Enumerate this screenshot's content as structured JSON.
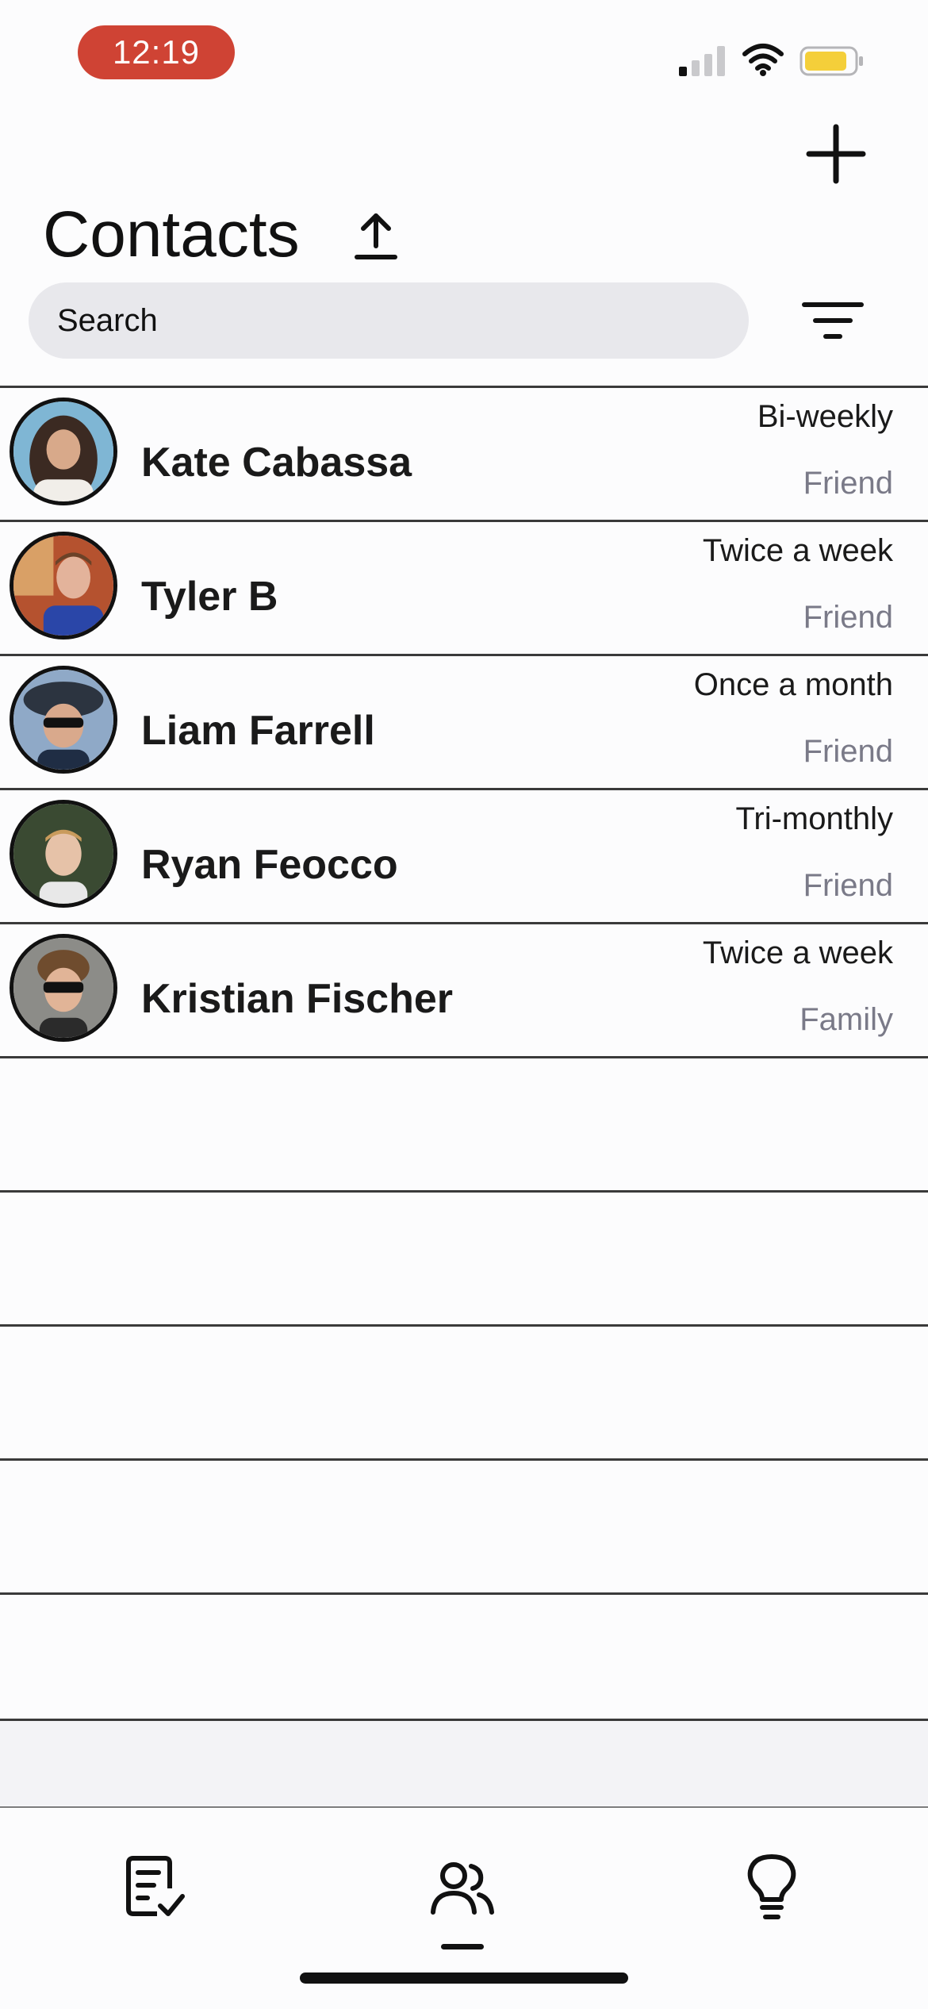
{
  "status_bar": {
    "time": "12:19",
    "time_pill_color": "#cf4334",
    "signal_icon": "cellular-signal-icon",
    "wifi_icon": "wifi-icon",
    "battery_icon": "battery-icon",
    "battery_color": "#f4cf3a"
  },
  "header": {
    "title": "Contacts",
    "add_icon": "plus-icon",
    "export_icon": "upload-arrow-icon",
    "filter_icon": "filter-icon"
  },
  "search": {
    "placeholder": "Search",
    "value": ""
  },
  "contacts": [
    {
      "name": "Kate Cabassa",
      "frequency": "Bi-weekly",
      "relationship": "Friend"
    },
    {
      "name": "Tyler B",
      "frequency": "Twice a week",
      "relationship": "Friend"
    },
    {
      "name": "Liam Farrell",
      "frequency": "Once a month",
      "relationship": "Friend"
    },
    {
      "name": "Ryan Feocco",
      "frequency": "Tri-monthly",
      "relationship": "Friend"
    },
    {
      "name": "Kristian Fischer",
      "frequency": "Twice a week",
      "relationship": "Family"
    }
  ],
  "tab_bar": {
    "tabs": [
      {
        "icon": "checklist-icon",
        "active": false
      },
      {
        "icon": "contacts-icon",
        "active": true
      },
      {
        "icon": "lightbulb-icon",
        "active": false
      }
    ]
  }
}
